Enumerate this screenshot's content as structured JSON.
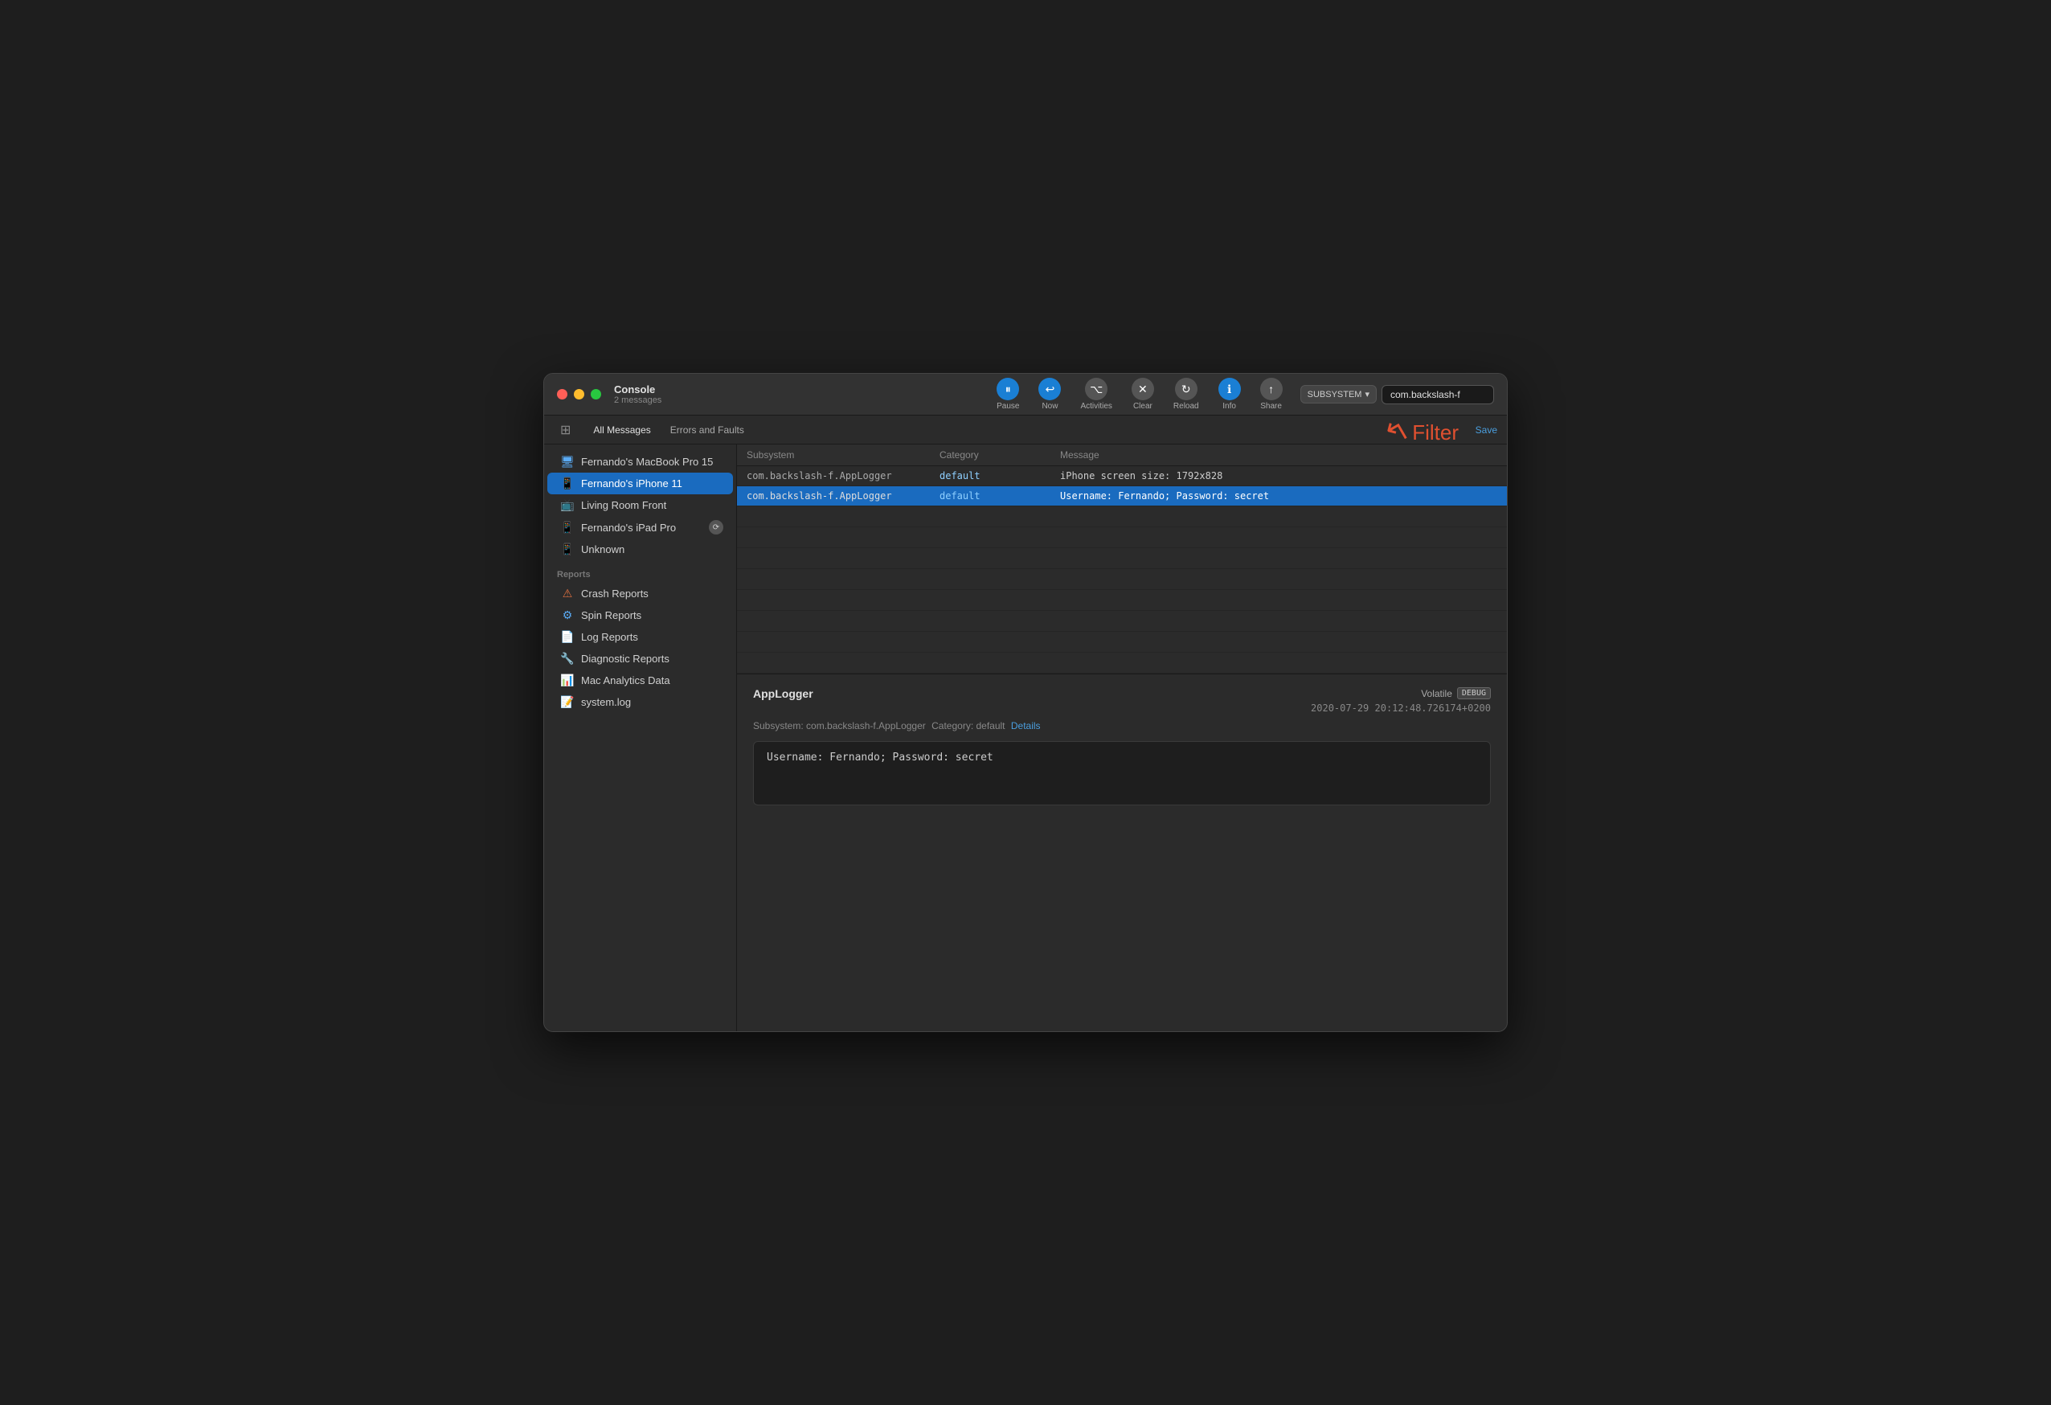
{
  "window": {
    "title": "Console",
    "subtitle": "2 messages"
  },
  "toolbar": {
    "pause_label": "Pause",
    "now_label": "Now",
    "activities_label": "Activities",
    "clear_label": "Clear",
    "reload_label": "Reload",
    "info_label": "Info",
    "share_label": "Share",
    "subsystem_label": "SUBSYSTEM",
    "search_value": "com.backslash-f",
    "save_label": "Save"
  },
  "tabs": {
    "all_messages": "All Messages",
    "errors_faults": "Errors and Faults"
  },
  "sidebar": {
    "devices": [
      {
        "id": "macbook",
        "label": "Fernando's MacBook Pro 15",
        "icon": "💻",
        "type": "macbook"
      },
      {
        "id": "iphone",
        "label": "Fernando's iPhone 11",
        "icon": "📱",
        "type": "iphone",
        "selected": true
      },
      {
        "id": "livingroom",
        "label": "Living Room Front",
        "icon": "📺",
        "type": "tv"
      },
      {
        "id": "ipad",
        "label": "Fernando's iPad Pro",
        "icon": "📱",
        "type": "ipad"
      },
      {
        "id": "unknown",
        "label": "Unknown",
        "icon": "📱",
        "type": "unknown"
      }
    ],
    "reports_section": "Reports",
    "reports": [
      {
        "id": "crash",
        "label": "Crash Reports",
        "icon": "⚠"
      },
      {
        "id": "spin",
        "label": "Spin Reports",
        "icon": "⚙"
      },
      {
        "id": "log",
        "label": "Log Reports",
        "icon": "📄"
      },
      {
        "id": "diagnostic",
        "label": "Diagnostic Reports",
        "icon": "🔧"
      },
      {
        "id": "analytics",
        "label": "Mac Analytics Data",
        "icon": "📊"
      },
      {
        "id": "syslog",
        "label": "system.log",
        "icon": "📝"
      }
    ]
  },
  "table": {
    "columns": [
      "Subsystem",
      "Category",
      "Message"
    ],
    "rows": [
      {
        "subsystem": "com.backslash-f.AppLogger",
        "category": "default",
        "message": "iPhone screen size: 1792x828",
        "selected": false
      },
      {
        "subsystem": "com.backslash-f.AppLogger",
        "category": "default",
        "message": "Username: Fernando; Password: secret",
        "selected": true
      }
    ]
  },
  "detail": {
    "title": "AppLogger",
    "volatile_label": "Volatile",
    "debug_label": "DEBUG",
    "timestamp": "2020-07-29 20:12:48.726174+0200",
    "subsystem_prefix": "Subsystem: com.backslash-f.AppLogger",
    "category_prefix": "Category: default",
    "details_link": "Details",
    "message": "Username: Fernando; Password: secret"
  },
  "filter_annotation": {
    "arrow": "↗",
    "label": "Filter"
  }
}
